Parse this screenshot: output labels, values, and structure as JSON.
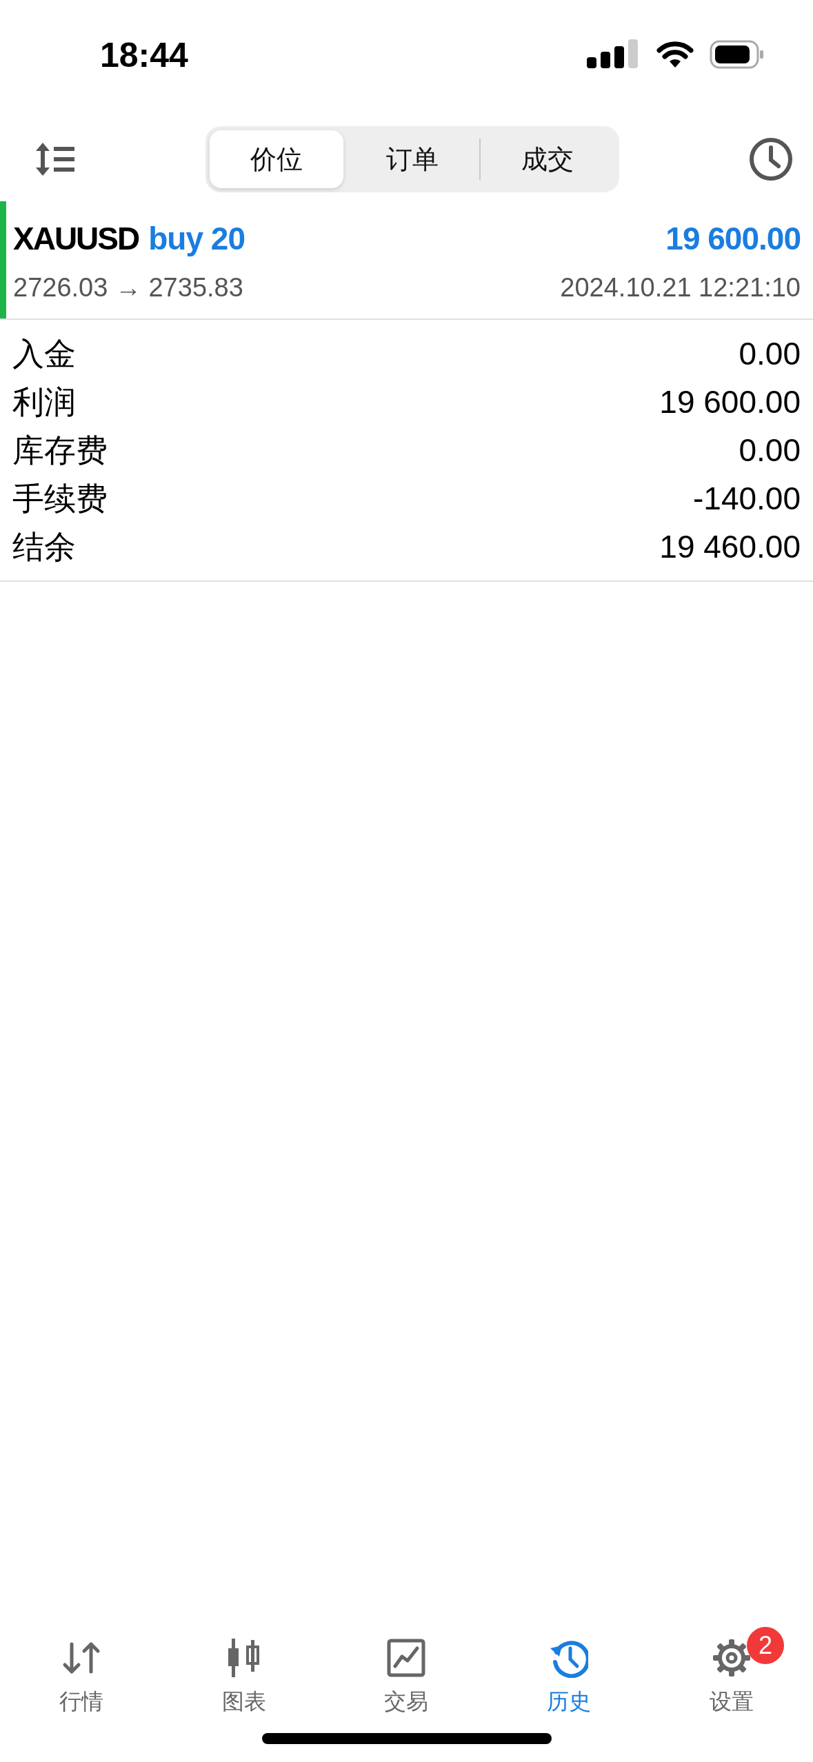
{
  "status_bar": {
    "time": "18:44"
  },
  "segments": [
    {
      "label": "价位",
      "selected": true
    },
    {
      "label": "订单",
      "selected": false
    },
    {
      "label": "成交",
      "selected": false
    }
  ],
  "trade": {
    "symbol": "XAUUSD",
    "side": "buy 20",
    "profit": "19 600.00",
    "prices": "2726.03 → 2735.83",
    "time": "2024.10.21 12:21:10"
  },
  "summary": [
    {
      "label": "入金",
      "value": "0.00"
    },
    {
      "label": "利润",
      "value": "19 600.00"
    },
    {
      "label": "库存费",
      "value": "0.00"
    },
    {
      "label": "手续费",
      "value": "-140.00"
    },
    {
      "label": "结余",
      "value": "19 460.00"
    }
  ],
  "tab_bar": [
    {
      "kind": "quotes",
      "label": "行情",
      "selected": false
    },
    {
      "kind": "chart",
      "label": "图表",
      "selected": false
    },
    {
      "kind": "trade",
      "label": "交易",
      "selected": false
    },
    {
      "kind": "history",
      "label": "历史",
      "selected": true
    },
    {
      "kind": "settings",
      "label": "设置",
      "selected": false,
      "badge": "2"
    }
  ]
}
